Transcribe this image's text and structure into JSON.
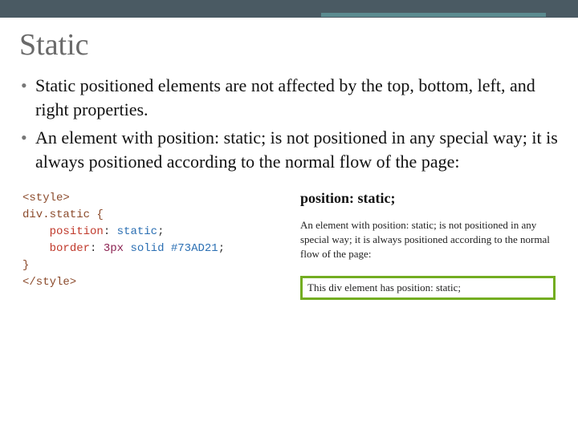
{
  "title": "Static",
  "bullets": [
    "Static positioned elements are not affected by the top, bottom, left, and right properties.",
    "An element with position: static; is not positioned in any special way; it is always positioned according to the normal flow of the page:"
  ],
  "code": {
    "open_tag": "<style>",
    "selector": "div.static {",
    "prop1_name": "position",
    "prop1_value": "static",
    "prop2_name": "border",
    "prop2_value_num": "3px",
    "prop2_value_rest": "solid #73AD21",
    "close_brace": "}",
    "close_tag": "</style>"
  },
  "preview": {
    "heading": "position: static;",
    "text": "An element with position: static; is not positioned in any special way; it is always positioned according to the normal flow of the page:",
    "box_text": "This div element has position: static;"
  }
}
